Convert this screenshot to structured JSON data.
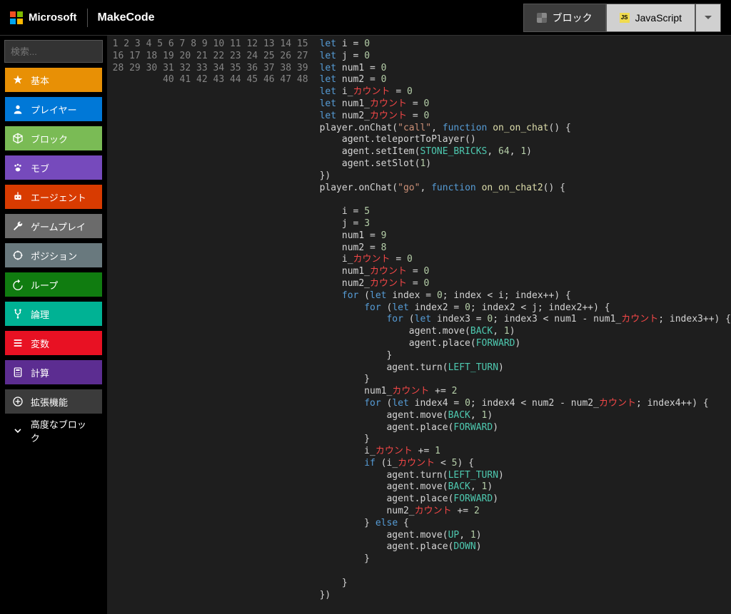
{
  "header": {
    "microsoft": "Microsoft",
    "brand": "MakeCode",
    "blocks_label": "ブロック",
    "js_label": "JavaScript",
    "js_badge": "JS"
  },
  "search": {
    "placeholder": "検索..."
  },
  "categories": [
    {
      "id": "basic",
      "label": "基本",
      "bg": "#e89005",
      "icon": "star"
    },
    {
      "id": "player",
      "label": "プレイヤー",
      "bg": "#0078d7",
      "icon": "user"
    },
    {
      "id": "block",
      "label": "ブロック",
      "bg": "#7abb55",
      "icon": "cube"
    },
    {
      "id": "mob",
      "label": "モブ",
      "bg": "#764abc",
      "icon": "paw"
    },
    {
      "id": "agent",
      "label": "エージェント",
      "bg": "#d83b01",
      "icon": "robot"
    },
    {
      "id": "gameplay",
      "label": "ゲームプレイ",
      "bg": "#6b6b6b",
      "icon": "wrench"
    },
    {
      "id": "position",
      "label": "ポジション",
      "bg": "#69797e",
      "icon": "crosshair"
    },
    {
      "id": "loop",
      "label": "ループ",
      "bg": "#107c10",
      "icon": "loop"
    },
    {
      "id": "logic",
      "label": "論理",
      "bg": "#00b294",
      "icon": "fork"
    },
    {
      "id": "variable",
      "label": "変数",
      "bg": "#e81123",
      "icon": "list"
    },
    {
      "id": "math",
      "label": "計算",
      "bg": "#5c2d91",
      "icon": "calc"
    },
    {
      "id": "extensions",
      "label": "拡張機能",
      "bg": "#3b3b3b",
      "icon": "plus"
    },
    {
      "id": "advanced",
      "label": "高度なブロック",
      "bg": "#000000",
      "icon": "chev"
    }
  ],
  "code": {
    "line_count": 48,
    "lines": [
      [
        [
          "kw",
          "let"
        ],
        [
          "pl",
          " i "
        ],
        [
          "pl",
          "= "
        ],
        [
          "num",
          "0"
        ]
      ],
      [
        [
          "kw",
          "let"
        ],
        [
          "pl",
          " j "
        ],
        [
          "pl",
          "= "
        ],
        [
          "num",
          "0"
        ]
      ],
      [
        [
          "kw",
          "let"
        ],
        [
          "pl",
          " num1 "
        ],
        [
          "pl",
          "= "
        ],
        [
          "num",
          "0"
        ]
      ],
      [
        [
          "kw",
          "let"
        ],
        [
          "pl",
          " num2 "
        ],
        [
          "pl",
          "= "
        ],
        [
          "num",
          "0"
        ]
      ],
      [
        [
          "kw",
          "let"
        ],
        [
          "pl",
          " i_"
        ],
        [
          "err",
          "カウント"
        ],
        [
          "pl",
          " = "
        ],
        [
          "num",
          "0"
        ]
      ],
      [
        [
          "kw",
          "let"
        ],
        [
          "pl",
          " num1_"
        ],
        [
          "err",
          "カウント"
        ],
        [
          "pl",
          " = "
        ],
        [
          "num",
          "0"
        ]
      ],
      [
        [
          "kw",
          "let"
        ],
        [
          "pl",
          " num2_"
        ],
        [
          "err",
          "カウント"
        ],
        [
          "pl",
          " = "
        ],
        [
          "num",
          "0"
        ]
      ],
      [
        [
          "pl",
          "player.onChat("
        ],
        [
          "str",
          "\"call\""
        ],
        [
          "pl",
          ", "
        ],
        [
          "kw",
          "function"
        ],
        [
          "pl",
          " "
        ],
        [
          "fn",
          "on_on_chat"
        ],
        [
          "pl",
          "() {"
        ]
      ],
      [
        [
          "pl",
          "    agent.teleportToPlayer()"
        ]
      ],
      [
        [
          "pl",
          "    agent.setItem("
        ],
        [
          "const",
          "STONE_BRICKS"
        ],
        [
          "pl",
          ", "
        ],
        [
          "num",
          "64"
        ],
        [
          "pl",
          ", "
        ],
        [
          "num",
          "1"
        ],
        [
          "pl",
          ")"
        ]
      ],
      [
        [
          "pl",
          "    agent.setSlot("
        ],
        [
          "num",
          "1"
        ],
        [
          "pl",
          ")"
        ]
      ],
      [
        [
          "pl",
          "})"
        ]
      ],
      [
        [
          "pl",
          "player.onChat("
        ],
        [
          "str",
          "\"go\""
        ],
        [
          "pl",
          ", "
        ],
        [
          "kw",
          "function"
        ],
        [
          "pl",
          " "
        ],
        [
          "fn",
          "on_on_chat2"
        ],
        [
          "pl",
          "() {"
        ]
      ],
      [
        [
          "pl",
          "    "
        ]
      ],
      [
        [
          "pl",
          "    i = "
        ],
        [
          "num",
          "5"
        ]
      ],
      [
        [
          "pl",
          "    j = "
        ],
        [
          "num",
          "3"
        ]
      ],
      [
        [
          "pl",
          "    num1 = "
        ],
        [
          "num",
          "9"
        ]
      ],
      [
        [
          "pl",
          "    num2 = "
        ],
        [
          "num",
          "8"
        ]
      ],
      [
        [
          "pl",
          "    i_"
        ],
        [
          "err",
          "カウント"
        ],
        [
          "pl",
          " = "
        ],
        [
          "num",
          "0"
        ]
      ],
      [
        [
          "pl",
          "    num1_"
        ],
        [
          "err",
          "カウント"
        ],
        [
          "pl",
          " = "
        ],
        [
          "num",
          "0"
        ]
      ],
      [
        [
          "pl",
          "    num2_"
        ],
        [
          "err",
          "カウント"
        ],
        [
          "pl",
          " = "
        ],
        [
          "num",
          "0"
        ]
      ],
      [
        [
          "pl",
          "    "
        ],
        [
          "kw",
          "for"
        ],
        [
          "pl",
          " ("
        ],
        [
          "kw",
          "let"
        ],
        [
          "pl",
          " index = "
        ],
        [
          "num",
          "0"
        ],
        [
          "pl",
          "; index < i; index++) {"
        ]
      ],
      [
        [
          "pl",
          "        "
        ],
        [
          "kw",
          "for"
        ],
        [
          "pl",
          " ("
        ],
        [
          "kw",
          "let"
        ],
        [
          "pl",
          " index2 = "
        ],
        [
          "num",
          "0"
        ],
        [
          "pl",
          "; index2 < j; index2++) {"
        ]
      ],
      [
        [
          "pl",
          "            "
        ],
        [
          "kw",
          "for"
        ],
        [
          "pl",
          " ("
        ],
        [
          "kw",
          "let"
        ],
        [
          "pl",
          " index3 = "
        ],
        [
          "num",
          "0"
        ],
        [
          "pl",
          "; index3 < num1 - num1_"
        ],
        [
          "err",
          "カウント"
        ],
        [
          "pl",
          "; index3++) {"
        ]
      ],
      [
        [
          "pl",
          "                agent.move("
        ],
        [
          "const",
          "BACK"
        ],
        [
          "pl",
          ", "
        ],
        [
          "num",
          "1"
        ],
        [
          "pl",
          ")"
        ]
      ],
      [
        [
          "pl",
          "                agent.place("
        ],
        [
          "const",
          "FORWARD"
        ],
        [
          "pl",
          ")"
        ]
      ],
      [
        [
          "pl",
          "            }"
        ]
      ],
      [
        [
          "pl",
          "            agent.turn("
        ],
        [
          "const",
          "LEFT_TURN"
        ],
        [
          "pl",
          ")"
        ]
      ],
      [
        [
          "pl",
          "        }"
        ]
      ],
      [
        [
          "pl",
          "        num1_"
        ],
        [
          "err",
          "カウント"
        ],
        [
          "pl",
          " += "
        ],
        [
          "num",
          "2"
        ]
      ],
      [
        [
          "pl",
          "        "
        ],
        [
          "kw",
          "for"
        ],
        [
          "pl",
          " ("
        ],
        [
          "kw",
          "let"
        ],
        [
          "pl",
          " index4 = "
        ],
        [
          "num",
          "0"
        ],
        [
          "pl",
          "; index4 < num2 - num2_"
        ],
        [
          "err",
          "カウント"
        ],
        [
          "pl",
          "; index4++) {"
        ]
      ],
      [
        [
          "pl",
          "            agent.move("
        ],
        [
          "const",
          "BACK"
        ],
        [
          "pl",
          ", "
        ],
        [
          "num",
          "1"
        ],
        [
          "pl",
          ")"
        ]
      ],
      [
        [
          "pl",
          "            agent.place("
        ],
        [
          "const",
          "FORWARD"
        ],
        [
          "pl",
          ")"
        ]
      ],
      [
        [
          "pl",
          "        }"
        ]
      ],
      [
        [
          "pl",
          "        i_"
        ],
        [
          "err",
          "カウント"
        ],
        [
          "pl",
          " += "
        ],
        [
          "num",
          "1"
        ]
      ],
      [
        [
          "pl",
          "        "
        ],
        [
          "kw",
          "if"
        ],
        [
          "pl",
          " (i_"
        ],
        [
          "err",
          "カウント"
        ],
        [
          "pl",
          " < "
        ],
        [
          "num",
          "5"
        ],
        [
          "pl",
          ") {"
        ]
      ],
      [
        [
          "pl",
          "            agent.turn("
        ],
        [
          "const",
          "LEFT_TURN"
        ],
        [
          "pl",
          ")"
        ]
      ],
      [
        [
          "pl",
          "            agent.move("
        ],
        [
          "const",
          "BACK"
        ],
        [
          "pl",
          ", "
        ],
        [
          "num",
          "1"
        ],
        [
          "pl",
          ")"
        ]
      ],
      [
        [
          "pl",
          "            agent.place("
        ],
        [
          "const",
          "FORWARD"
        ],
        [
          "pl",
          ")"
        ]
      ],
      [
        [
          "pl",
          "            num2_"
        ],
        [
          "err",
          "カウント"
        ],
        [
          "pl",
          " += "
        ],
        [
          "num",
          "2"
        ]
      ],
      [
        [
          "pl",
          "        } "
        ],
        [
          "kw",
          "else"
        ],
        [
          "pl",
          " {"
        ]
      ],
      [
        [
          "pl",
          "            agent.move("
        ],
        [
          "const",
          "UP"
        ],
        [
          "pl",
          ", "
        ],
        [
          "num",
          "1"
        ],
        [
          "pl",
          ")"
        ]
      ],
      [
        [
          "pl",
          "            agent.place("
        ],
        [
          "const",
          "DOWN"
        ],
        [
          "pl",
          ")"
        ]
      ],
      [
        [
          "pl",
          "        }"
        ]
      ],
      [
        [
          "pl",
          "        "
        ]
      ],
      [
        [
          "pl",
          "    }"
        ]
      ],
      [
        [
          "pl",
          "})"
        ]
      ],
      [
        [
          "pl",
          ""
        ]
      ]
    ]
  }
}
